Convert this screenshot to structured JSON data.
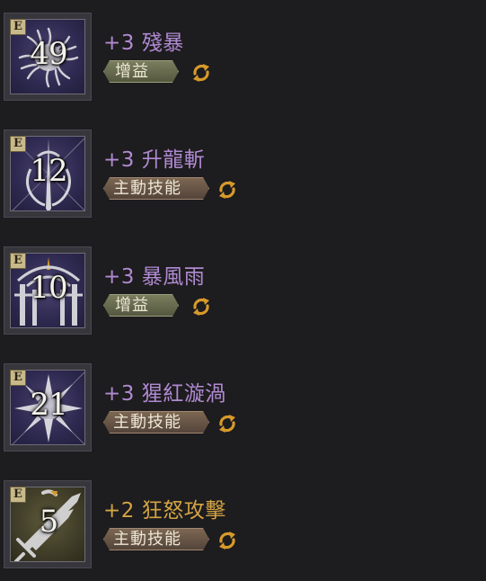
{
  "colors": {
    "title_purple": "#b08ad2",
    "title_gold": "#d4a443",
    "refresh_icon": "#d79a2a",
    "buff_tag": "#6c7050",
    "active_tag": "#6e5a48"
  },
  "rows": [
    {
      "badge": "E",
      "rank": "49",
      "title": "+3 殘暴",
      "tag": "增益",
      "tag_type": "buff",
      "title_color": "purple",
      "bg": "purple",
      "icon": "brutality-sunburst-icon"
    },
    {
      "badge": "E",
      "rank": "12",
      "title": "+3 升龍斬",
      "tag": "主動技能",
      "tag_type": "active",
      "title_color": "purple",
      "bg": "purple",
      "icon": "rising-dragon-blade-icon"
    },
    {
      "badge": "E",
      "rank": "10",
      "title": "+3 暴風雨",
      "tag": "增益",
      "tag_type": "buff",
      "title_color": "purple",
      "bg": "purple",
      "icon": "storm-gate-icon"
    },
    {
      "badge": "E",
      "rank": "21",
      "title": "+3 猩紅漩渦",
      "tag": "主動技能",
      "tag_type": "active",
      "title_color": "purple",
      "bg": "purple",
      "icon": "crimson-vortex-icon"
    },
    {
      "badge": "E",
      "rank": "5",
      "title": "+2 狂怒攻擊",
      "tag": "主動技能",
      "tag_type": "active",
      "title_color": "gold",
      "bg": "olive",
      "icon": "frenzy-strike-swords-icon"
    }
  ]
}
